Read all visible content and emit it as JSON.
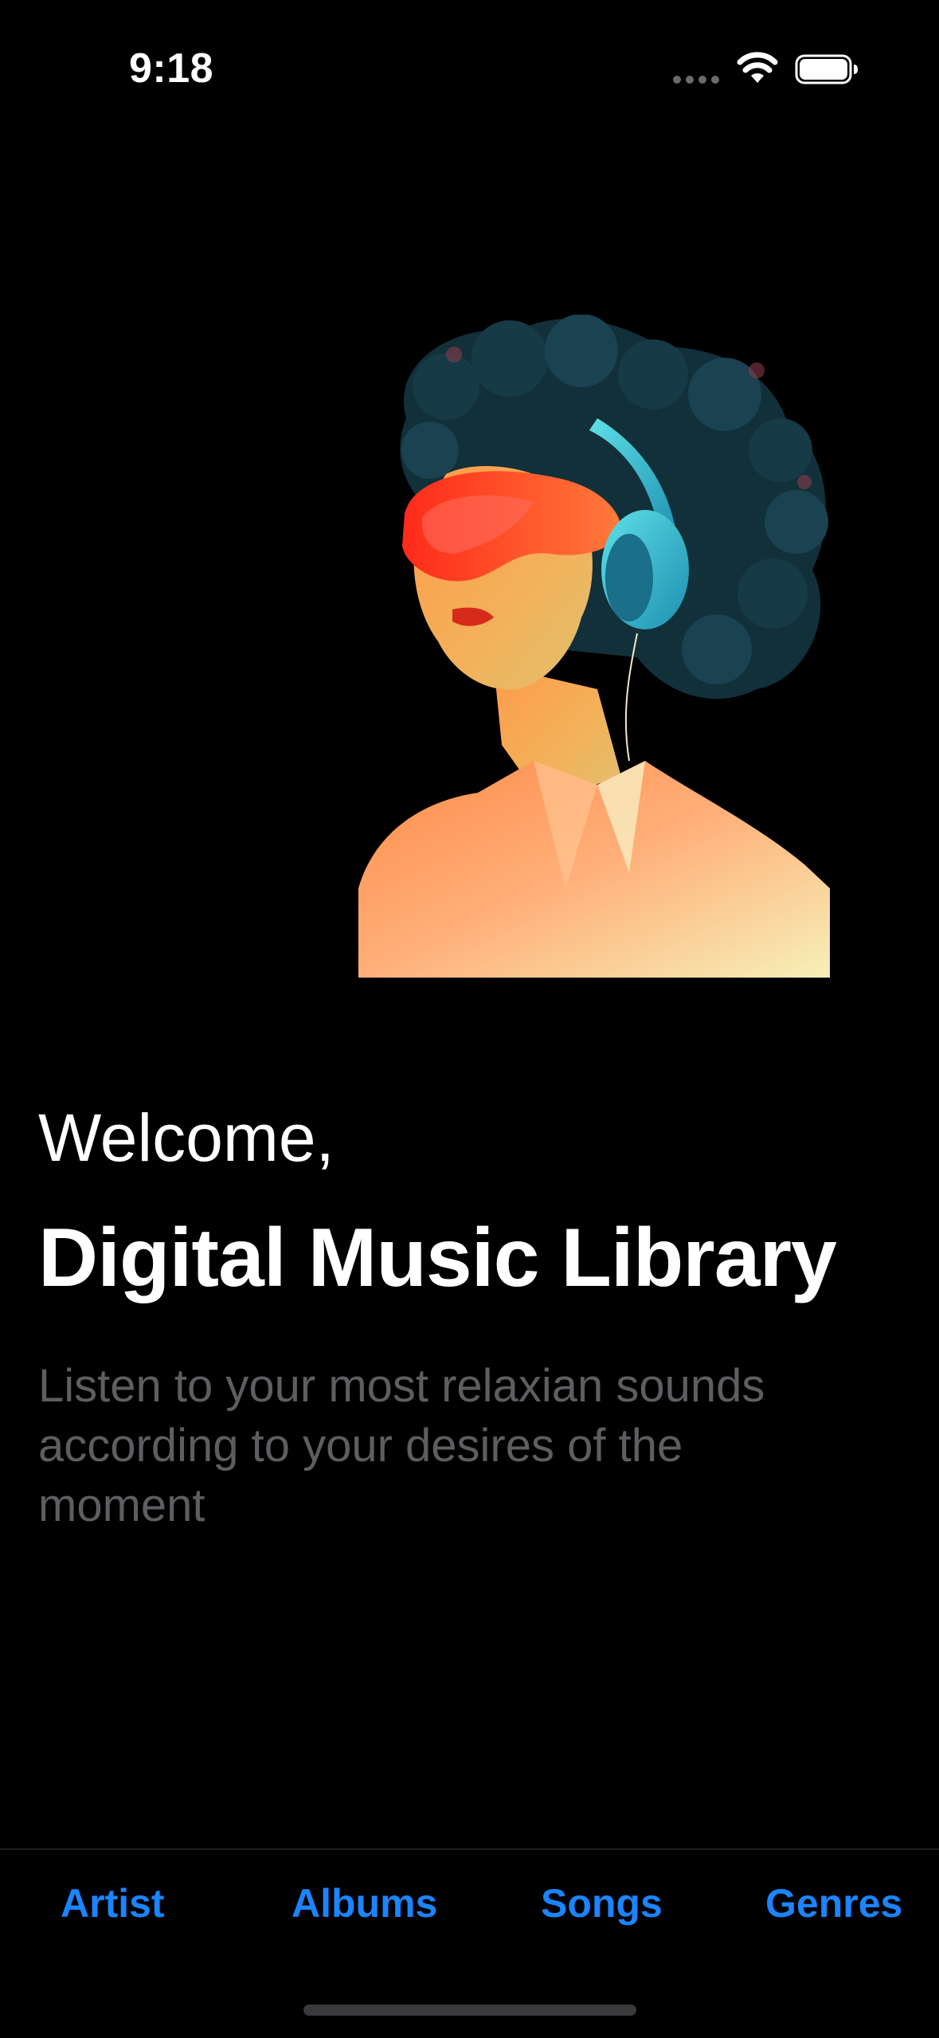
{
  "status_bar": {
    "time": "9:18",
    "icons": [
      "cellular-signal-icon",
      "wifi-icon",
      "battery-icon"
    ]
  },
  "hero": {
    "image": "woman-with-headphones-illustration"
  },
  "content": {
    "welcome": "Welcome,",
    "title": "Digital Music Library",
    "description": "Listen to your most relaxian sounds according to your desires of the moment"
  },
  "tab_bar": {
    "tabs": [
      {
        "label": "Artist"
      },
      {
        "label": "Albums"
      },
      {
        "label": "Songs"
      },
      {
        "label": "Genres"
      }
    ],
    "accent_color": "#1b84ff"
  },
  "colors": {
    "background": "#000000",
    "description_text": "#5e5e62"
  }
}
